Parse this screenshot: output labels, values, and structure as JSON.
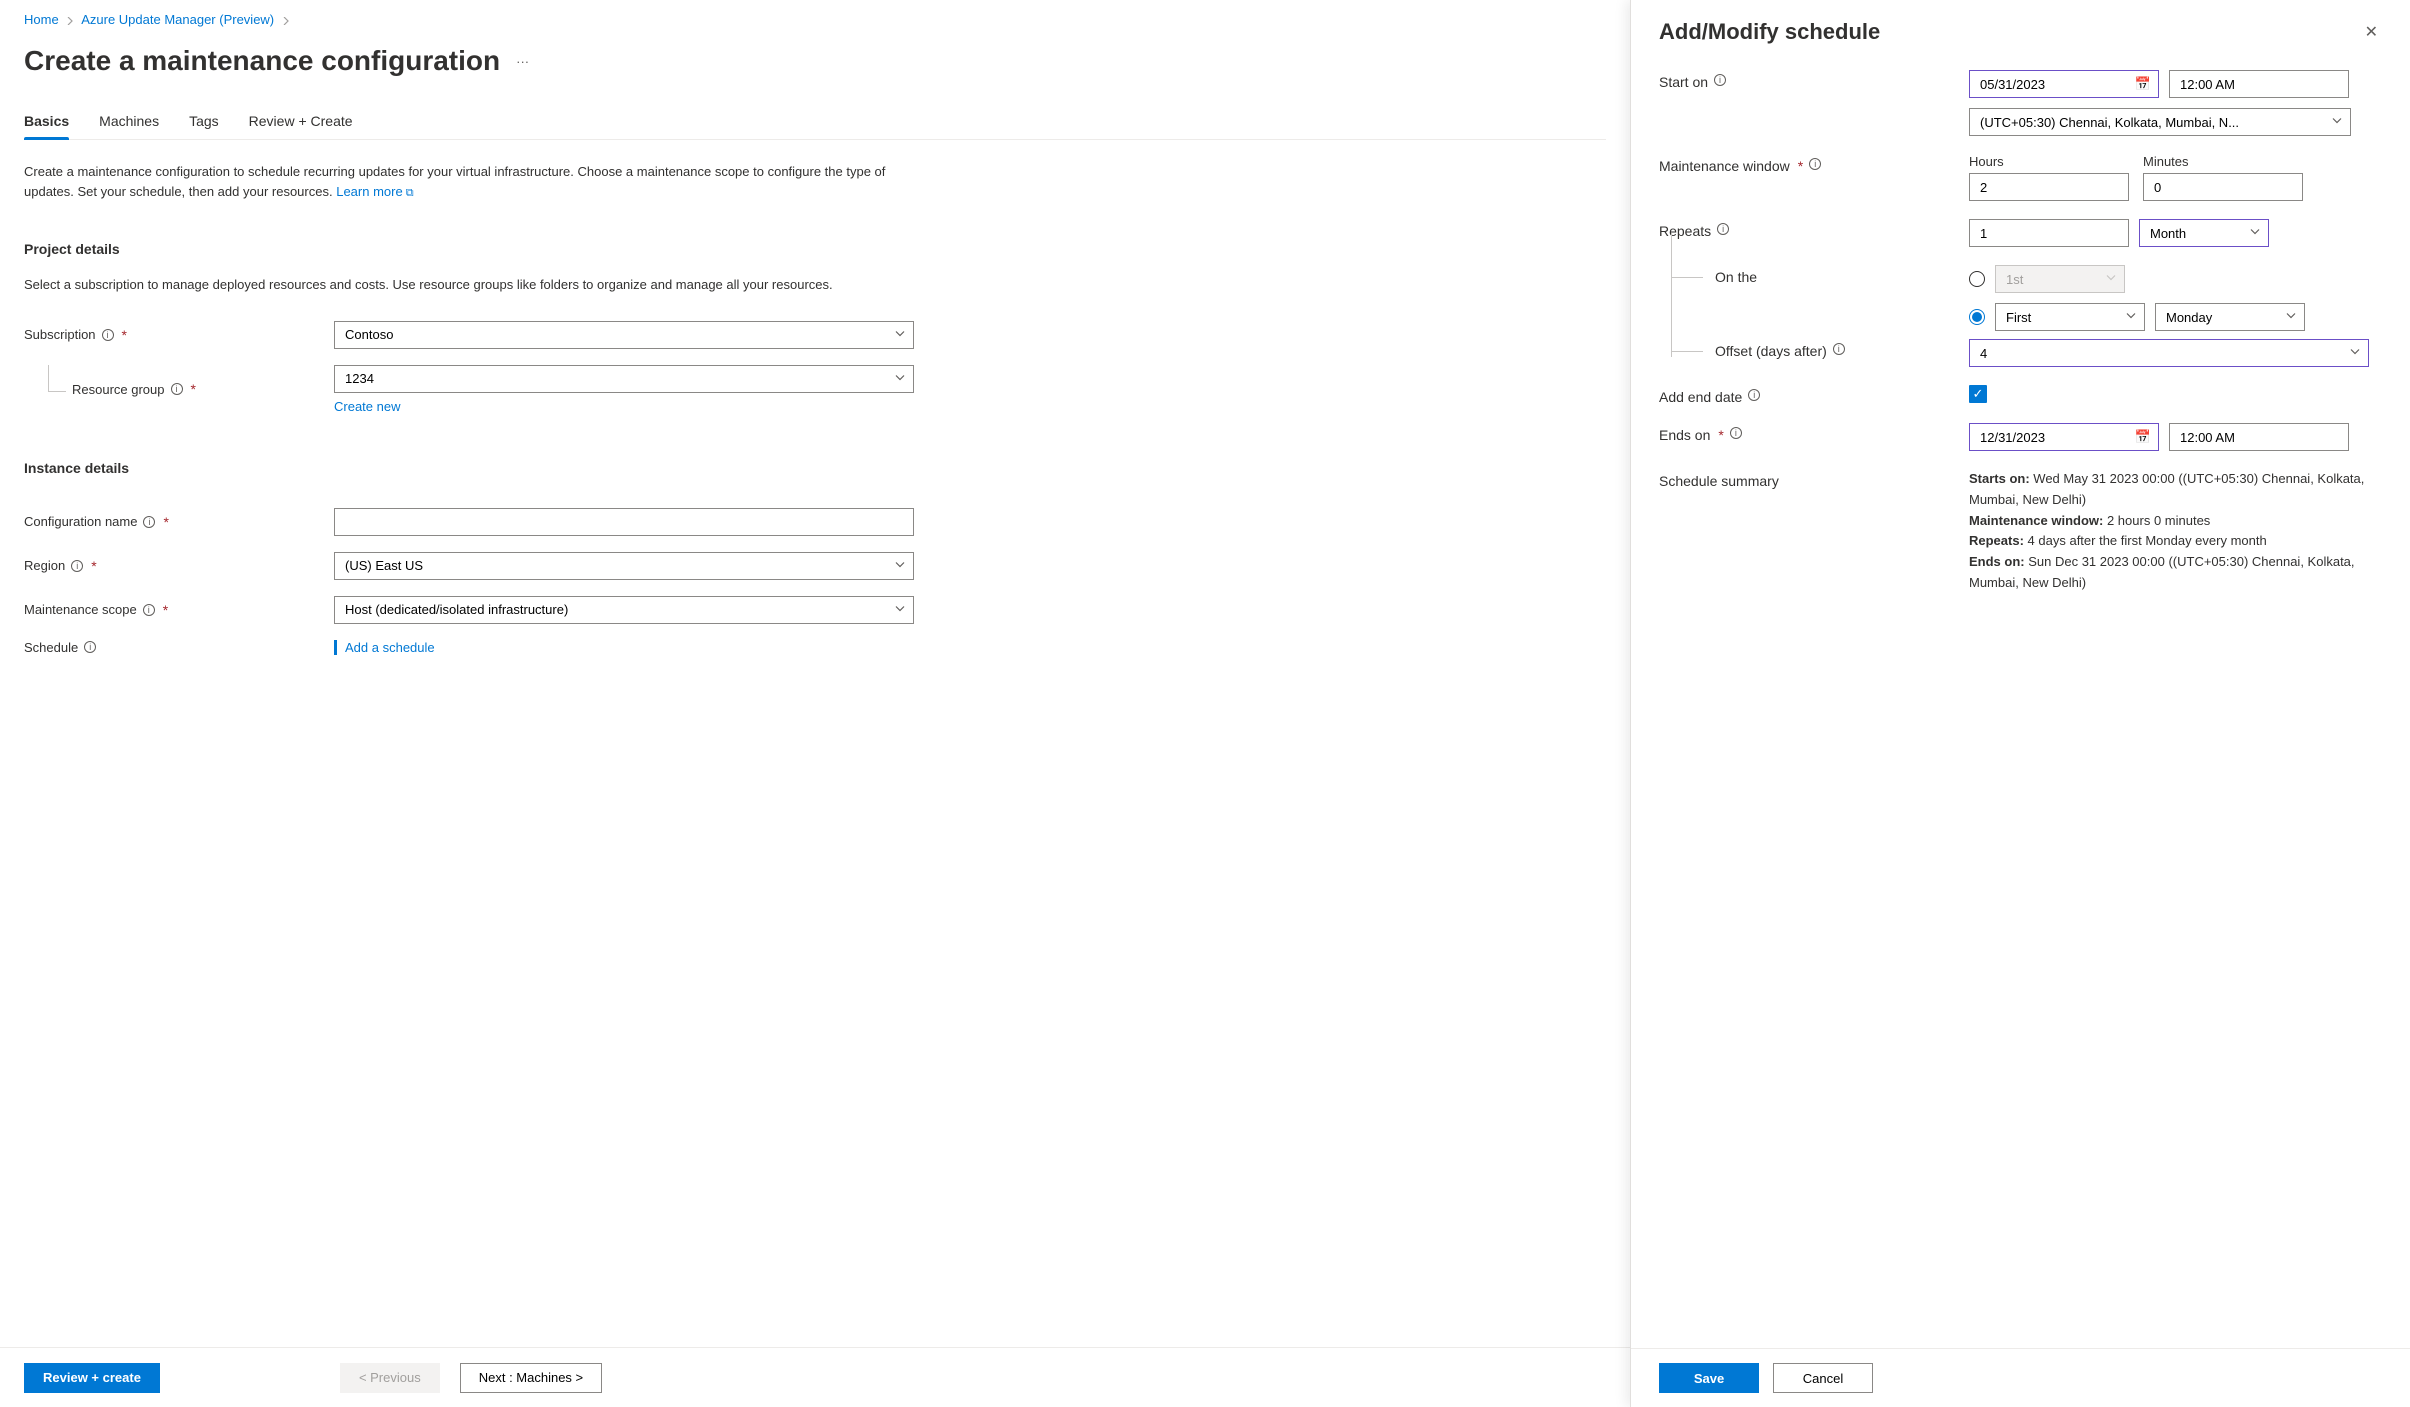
{
  "breadcrumb": {
    "home": "Home",
    "parent": "Azure Update Manager (Preview)"
  },
  "page_title": "Create a maintenance configuration",
  "tabs": {
    "basics": "Basics",
    "machines": "Machines",
    "tags": "Tags",
    "review": "Review + Create"
  },
  "intro": {
    "text": "Create a maintenance configuration to schedule recurring updates for your virtual infrastructure. Choose a maintenance scope to configure the type of updates. Set your schedule, then add your resources.",
    "learn_more": "Learn more"
  },
  "project": {
    "heading": "Project details",
    "desc": "Select a subscription to manage deployed resources and costs. Use resource groups like folders to organize and manage all your resources.",
    "subscription_label": "Subscription",
    "subscription_value": "Contoso",
    "rg_label": "Resource group",
    "rg_value": "1234",
    "create_new": "Create new"
  },
  "instance": {
    "heading": "Instance details",
    "config_name_label": "Configuration name",
    "config_name_value": "",
    "region_label": "Region",
    "region_value": "(US) East US",
    "scope_label": "Maintenance scope",
    "scope_value": "Host (dedicated/isolated infrastructure)",
    "schedule_label": "Schedule",
    "add_schedule": "Add a schedule"
  },
  "footer": {
    "review_create": "Review + create",
    "previous": "< Previous",
    "next": "Next : Machines >"
  },
  "panel": {
    "title": "Add/Modify schedule",
    "start_on_label": "Start on",
    "start_date": "05/31/2023",
    "start_time": "12:00 AM",
    "timezone": "(UTC+05:30) Chennai, Kolkata, Mumbai, N...",
    "maint_window_label": "Maintenance window",
    "hours_label": "Hours",
    "minutes_label": "Minutes",
    "hours_value": "2",
    "minutes_value": "0",
    "repeats_label": "Repeats",
    "repeats_count": "1",
    "repeats_unit": "Month",
    "on_the_label": "On the",
    "ordinal_disabled": "1st",
    "ordinal_selected": "First",
    "weekday_selected": "Monday",
    "offset_label": "Offset (days after)",
    "offset_value": "4",
    "add_end_label": "Add end date",
    "ends_on_label": "Ends on",
    "end_date": "12/31/2023",
    "end_time": "12:00 AM",
    "summary_label": "Schedule summary",
    "summary_starts_label": "Starts on:",
    "summary_starts_value": "Wed May 31 2023 00:00 ((UTC+05:30) Chennai, Kolkata, Mumbai, New Delhi)",
    "summary_window_label": "Maintenance window:",
    "summary_window_value": "2 hours 0 minutes",
    "summary_repeats_label": "Repeats:",
    "summary_repeats_value": "4 days after the first Monday every month",
    "summary_ends_label": "Ends on:",
    "summary_ends_value": "Sun Dec 31 2023 00:00 ((UTC+05:30) Chennai, Kolkata, Mumbai, New Delhi)",
    "save": "Save",
    "cancel": "Cancel"
  }
}
